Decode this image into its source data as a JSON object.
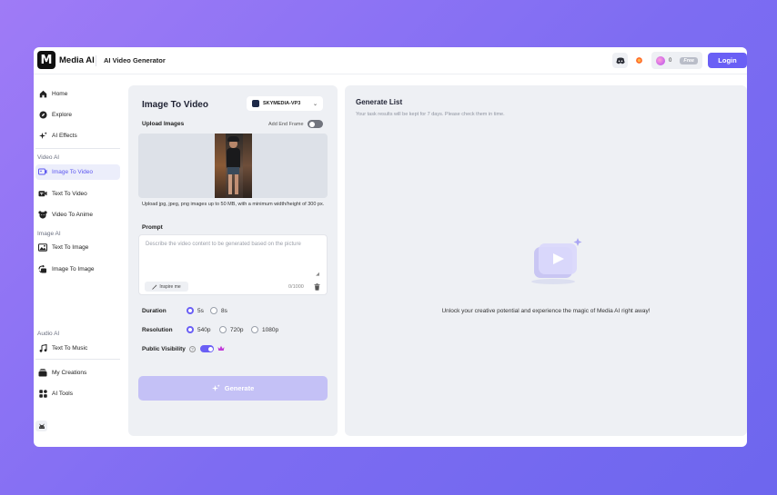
{
  "header": {
    "logo_letter": "M",
    "brand": "Media AI",
    "page_title": "AI Video Generator",
    "credits": "0",
    "plan_badge": "Free",
    "login_label": "Login",
    "icons": [
      "discord-icon",
      "fire-icon",
      "credits-gem-icon"
    ]
  },
  "sidebar": {
    "items": [
      {
        "label": "Home",
        "icon": "home-icon"
      },
      {
        "label": "Explore",
        "icon": "compass-icon"
      },
      {
        "label": "AI Effects",
        "icon": "sparkles-icon"
      },
      {
        "label": "Image To Video",
        "icon": "image-video-icon",
        "active": true
      },
      {
        "label": "Text To Video",
        "icon": "text-video-icon"
      },
      {
        "label": "Video To Anime",
        "icon": "anime-icon"
      },
      {
        "label": "Text To Image",
        "icon": "text-image-icon"
      },
      {
        "label": "Image To Image",
        "icon": "image-image-icon"
      },
      {
        "label": "Text To Music",
        "icon": "music-icon"
      },
      {
        "label": "My Creations",
        "icon": "creations-icon"
      },
      {
        "label": "AI Tools",
        "icon": "tools-icon"
      }
    ],
    "sections": {
      "video": "Video AI",
      "image": "Image AI",
      "audio": "Audio AI"
    }
  },
  "form": {
    "title": "Image To Video",
    "model": "SKYMEDIA-VP3",
    "upload_label": "Upload Images",
    "end_frame_label": "Add End Frame",
    "end_frame_enabled": false,
    "upload_hint": "Upload jpg, jpeg, png images up to 50 MB, with a minimum width/height of 300 px.",
    "prompt_label": "Prompt",
    "prompt_placeholder": "Describe the video content to be generated based on the picture",
    "inspire_label": "Inspire me",
    "char_count": "0/1000",
    "duration": {
      "label": "Duration",
      "options": [
        "5s",
        "8s"
      ],
      "selected": "5s"
    },
    "resolution": {
      "label": "Resolution",
      "options": [
        "540p",
        "720p",
        "1080p"
      ],
      "selected": "540p"
    },
    "visibility": {
      "label": "Public Visibility",
      "enabled": true
    },
    "generate_label": "Generate"
  },
  "results": {
    "title": "Generate List",
    "subtitle": "Your task results will be kept for 7 days. Please check them in time.",
    "empty_message": "Unlock your creative potential and experience the magic of Media AI right away!"
  },
  "colors": {
    "accent": "#6a5ff5",
    "generate_disabled": "#c4c1f6",
    "panel_bg": "#eef0f4",
    "background_gradient_start": "#9f7bf6",
    "background_gradient_end": "#6d66ee"
  }
}
